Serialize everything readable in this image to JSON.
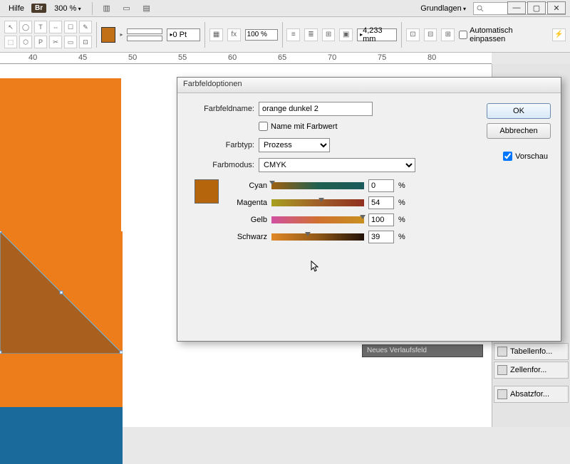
{
  "menubar": {
    "help": "Hilfe",
    "bridge": "Br",
    "zoom": "300 %",
    "workspace": "Grundlagen"
  },
  "toolbar": {
    "stroke_pt": "0 Pt",
    "fit_mm": "4,233 mm",
    "scale_pct": "100 %",
    "auto_fit": "Automatisch einpassen",
    "swatch_color": "#c27018"
  },
  "ruler": {
    "marks": [
      "40",
      "45",
      "50",
      "55",
      "60",
      "65",
      "70",
      "75",
      "80"
    ]
  },
  "dialog": {
    "title": "Farbfeldoptionen",
    "name_label": "Farbfeldname:",
    "name_value": "orange dunkel 2",
    "name_with_color": "Name mit Farbwert",
    "type_label": "Farbtyp:",
    "type_value": "Prozess",
    "mode_label": "Farbmodus:",
    "mode_value": "CMYK",
    "swatch_big_color": "#b5650b",
    "channels": {
      "c_label": "Cyan",
      "c_value": "0",
      "m_label": "Magenta",
      "m_value": "54",
      "y_label": "Gelb",
      "y_value": "100",
      "k_label": "Schwarz",
      "k_value": "39"
    },
    "ok": "OK",
    "cancel": "Abbrechen",
    "preview": "Vorschau",
    "preview_checked": true
  },
  "ctx_strip": "Neues Verlaufsfeld",
  "right_panels": {
    "table": "Tabellenfo...",
    "cell": "Zellenfor...",
    "para": "Absatzfor..."
  },
  "canvas": {
    "orange": "#ed7d1a",
    "brown": "#a9601f",
    "blue": "#1a6a9c"
  }
}
